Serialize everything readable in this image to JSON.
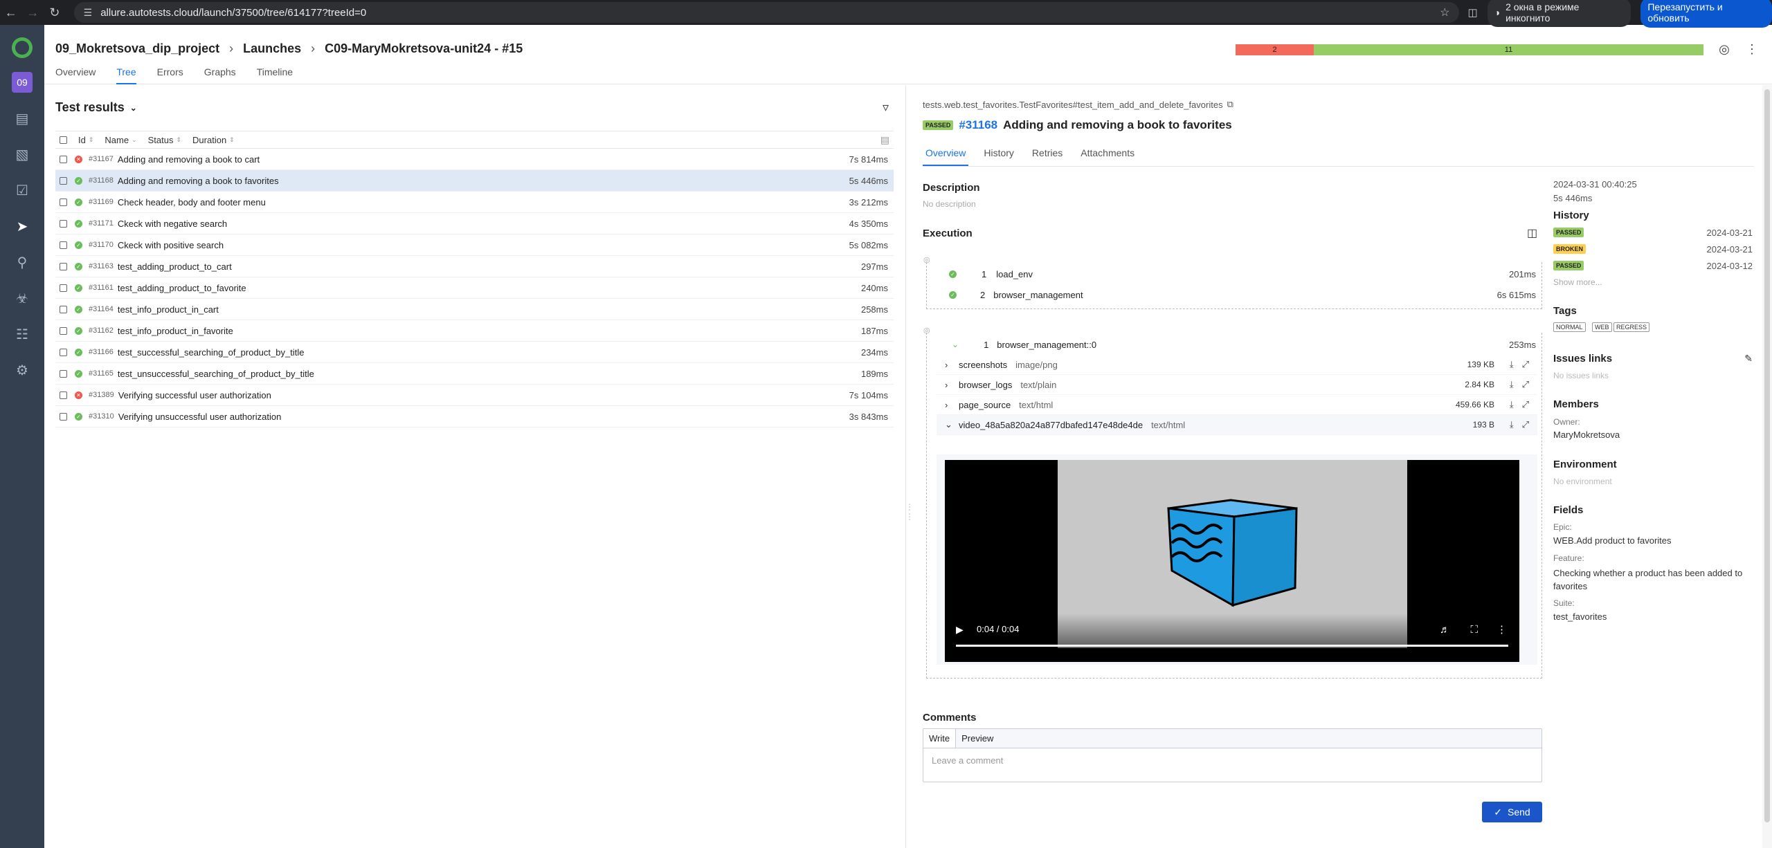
{
  "browser": {
    "url": "allure.autotests.cloud/launch/37500/tree/614177?treeId=0",
    "incognito_label": "2 окна в режиме инкогнито",
    "relaunch_label": "Перезапустить и обновить"
  },
  "sidebar": {
    "project_badge": "09"
  },
  "header": {
    "breadcrumb": [
      "09_Mokretsova_dip_project",
      "Launches",
      "C09-MaryMokretsova-unit24 - #15"
    ],
    "tabs": [
      "Overview",
      "Tree",
      "Errors",
      "Graphs",
      "Timeline"
    ],
    "active_tab": "Tree",
    "stats": {
      "failed": "2",
      "passed": "11"
    }
  },
  "test_results": {
    "title": "Test results",
    "columns": [
      "Id",
      "Name",
      "Status",
      "Duration"
    ],
    "rows": [
      {
        "id": "#31167",
        "name": "Adding and removing a book to cart",
        "status": "failed",
        "duration": "7s 814ms"
      },
      {
        "id": "#31168",
        "name": "Adding and removing a book to favorites",
        "status": "passed",
        "duration": "5s 446ms"
      },
      {
        "id": "#31169",
        "name": "Check header, body and footer menu",
        "status": "passed",
        "duration": "3s 212ms"
      },
      {
        "id": "#31171",
        "name": "Ckeck with negative search",
        "status": "passed",
        "duration": "4s 350ms"
      },
      {
        "id": "#31170",
        "name": "Ckeck with positive search",
        "status": "passed",
        "duration": "5s 082ms"
      },
      {
        "id": "#31163",
        "name": "test_adding_product_to_cart",
        "status": "passed",
        "duration": "297ms"
      },
      {
        "id": "#31161",
        "name": "test_adding_product_to_favorite",
        "status": "passed",
        "duration": "240ms"
      },
      {
        "id": "#31164",
        "name": "test_info_product_in_cart",
        "status": "passed",
        "duration": "258ms"
      },
      {
        "id": "#31162",
        "name": "test_info_product_in_favorite",
        "status": "passed",
        "duration": "187ms"
      },
      {
        "id": "#31166",
        "name": "test_successful_searching_of_product_by_title",
        "status": "passed",
        "duration": "234ms"
      },
      {
        "id": "#31165",
        "name": "test_unsuccessful_searching_of_product_by_title",
        "status": "passed",
        "duration": "189ms"
      },
      {
        "id": "#31389",
        "name": "Verifying successful user authorization",
        "status": "failed",
        "duration": "7s 104ms"
      },
      {
        "id": "#31310",
        "name": "Verifying unsuccessful user authorization",
        "status": "passed",
        "duration": "3s 843ms"
      }
    ]
  },
  "detail": {
    "path": "tests.web.test_favorites.TestFavorites#test_item_add_and_delete_favorites",
    "status_badge": "PASSED",
    "id": "#31168",
    "title": "Adding and removing a book to favorites",
    "tabs": [
      "Overview",
      "History",
      "Retries",
      "Attachments"
    ],
    "description_h": "Description",
    "description": "No description",
    "execution_h": "Execution",
    "steps": [
      {
        "n": "1",
        "name": "load_env",
        "duration": "201ms"
      },
      {
        "n": "2",
        "name": "browser_management",
        "duration": "6s 615ms"
      }
    ],
    "teardown": {
      "n": "1",
      "name": "browser_management::0",
      "duration": "253ms"
    },
    "attachments": [
      {
        "name": "screenshots",
        "type": "image/png",
        "size": "139 KB"
      },
      {
        "name": "browser_logs",
        "type": "text/plain",
        "size": "2.84 KB"
      },
      {
        "name": "page_source",
        "type": "text/html",
        "size": "459.66 KB"
      },
      {
        "name": "video_48a5a820a24a877dbafed147e48de4de",
        "type": "text/html",
        "size": "193 B"
      }
    ],
    "video_time": "0:04 / 0:04",
    "comments_h": "Comments",
    "comment_tabs": [
      "Write",
      "Preview"
    ],
    "comment_placeholder": "Leave a comment",
    "send_label": "Send"
  },
  "meta": {
    "date": "2024-03-31 00:40:25",
    "duration": "5s 446ms",
    "history_h": "History",
    "history": [
      {
        "status": "PASSED",
        "date": "2024-03-21"
      },
      {
        "status": "BROKEN",
        "date": "2024-03-21"
      },
      {
        "status": "PASSED",
        "date": "2024-03-12"
      }
    ],
    "show_more": "Show more...",
    "tags_h": "Tags",
    "tags": [
      "NORMAL",
      "WEB",
      "REGRESS"
    ],
    "issues_h": "Issues links",
    "issues": "No issues links",
    "members_h": "Members",
    "owner_label": "Owner:",
    "owner": "MaryMokretsova",
    "env_h": "Environment",
    "env": "No environment",
    "fields_h": "Fields",
    "epic_label": "Epic:",
    "epic": "WEB.Add product to favorites",
    "feature_label": "Feature:",
    "feature": "Checking whether a product has been added to favorites",
    "suite_label": "Suite:",
    "suite": "test_favorites"
  }
}
